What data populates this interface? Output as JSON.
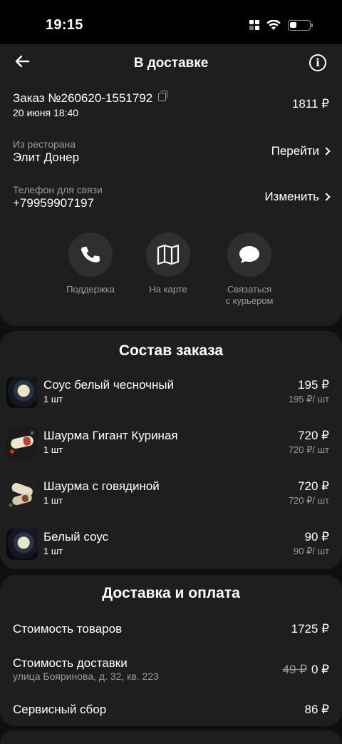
{
  "status": {
    "time": "19:15",
    "battery_level": 0.35
  },
  "nav": {
    "title": "В доставке",
    "info": "i"
  },
  "order": {
    "number_label": "Заказ №260620-1551792",
    "date": "20 июня 18:40",
    "total": "1811 ₽",
    "restaurant_caption": "Из ресторана",
    "restaurant_name": "Элит Донер",
    "restaurant_link": "Перейти",
    "phone_caption": "Телефон для связи",
    "phone": "+79959907197",
    "phone_link": "Изменить",
    "actions": [
      {
        "label": "Поддержка",
        "icon": "phone-icon"
      },
      {
        "label": "На карте",
        "icon": "map-icon"
      },
      {
        "label_line1": "Связаться",
        "label_line2": "с курьером",
        "icon": "chat-icon"
      }
    ]
  },
  "items_section": {
    "title": "Состав заказа",
    "items": [
      {
        "name": "Соус белый чесночный",
        "qty": "1 шт",
        "price": "195 ₽",
        "unit": "195 ₽/ шт"
      },
      {
        "name": "Шаурма Гигант Куриная",
        "qty": "1 шт",
        "price": "720 ₽",
        "unit": "720 ₽/ шт"
      },
      {
        "name": "Шаурма с говядиной",
        "qty": "1 шт",
        "price": "720 ₽",
        "unit": "720 ₽/ шт"
      },
      {
        "name": "Белый соус",
        "qty": "1 шт",
        "price": "90 ₽",
        "unit": "90 ₽/ шт"
      }
    ]
  },
  "delivery_section": {
    "title": "Доставка и оплата",
    "goods_label": "Стоимость товаров",
    "goods_value": "1725 ₽",
    "delivery_label": "Стоимость доставки",
    "delivery_address": "улица Бояринова, д. 32, кв. 223",
    "delivery_old": "49 ₽",
    "delivery_value": "0 ₽",
    "service_label": "Сервисный сбор",
    "service_value": "86 ₽"
  },
  "colors": {
    "background": "#0f0f0f",
    "card": "#1e1e1e",
    "muted": "#9a9a9a",
    "button": "#2f2f2f"
  }
}
